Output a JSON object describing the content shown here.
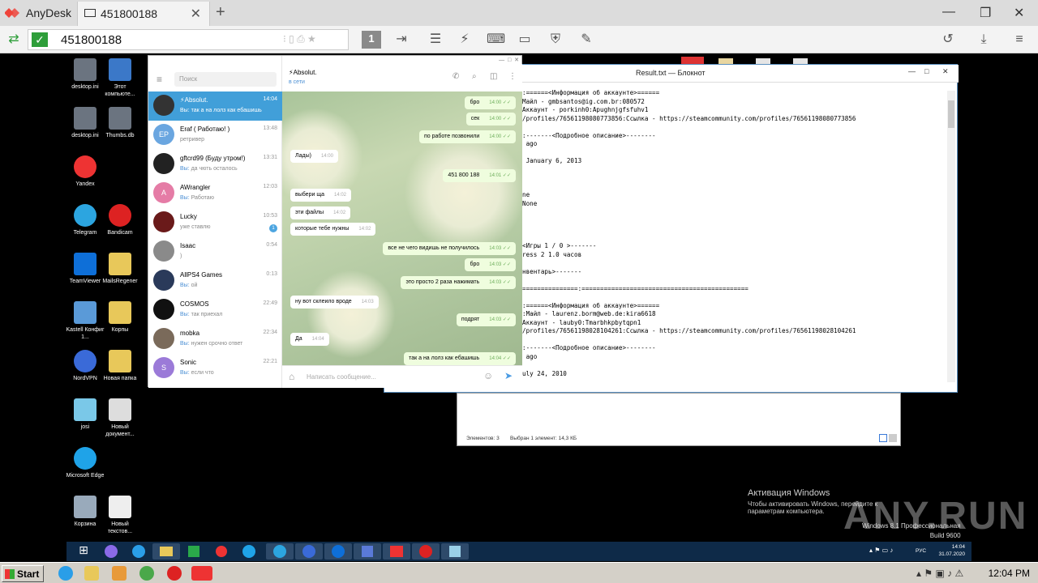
{
  "anydesk": {
    "app_name": "AnyDesk",
    "tab_label": "451800188",
    "address_value": "451800188",
    "monitor_label": "1"
  },
  "desktop_icons": [
    {
      "label": "desktop.ini",
      "color": "#6b7480"
    },
    {
      "label": "Этот компьюте...",
      "color": "#3b78c8"
    },
    {
      "label": "desktop.ini",
      "color": "#6b7480"
    },
    {
      "label": "Thumbs.db",
      "color": "#6b7480"
    },
    {
      "label": "Yandex",
      "color": "#e33"
    },
    {
      "label": "Telegram",
      "color": "#2ca5e0"
    },
    {
      "label": "Bandicam",
      "color": "#d22"
    },
    {
      "label": "TeamViewer",
      "color": "#0e6fd8"
    },
    {
      "label": "MailsRegener",
      "color": "#e8c85a"
    },
    {
      "label": "Kastell Конфиг 1...",
      "color": "#5a9ad8"
    },
    {
      "label": "Корпы",
      "color": "#e8c85a"
    },
    {
      "label": "NordVPN",
      "color": "#3a6ad8"
    },
    {
      "label": "Новая папка",
      "color": "#e8c85a"
    },
    {
      "label": "josi",
      "color": "#7ac8e8"
    },
    {
      "label": "Новый документ...",
      "color": "#dddddd"
    },
    {
      "label": "Microsoft Edge",
      "color": "#1fa3e8"
    },
    {
      "label": "Корзина",
      "color": "#9ab"
    },
    {
      "label": "Новый текстов...",
      "color": "#eeeeee"
    }
  ],
  "telegram": {
    "search_placeholder": "Поиск",
    "chats": [
      {
        "name": "⚡Absolut.",
        "preview": "Вы: так а на лолз как ебашишь",
        "time": "14:04",
        "avatar_color": "#333333",
        "avatar_text": ""
      },
      {
        "name": "Eraf ( Работаю! )",
        "preview": "ретривер",
        "time": "13:48",
        "avatar_color": "#6aa6e0",
        "avatar_text": "EP"
      },
      {
        "name": "gftcrd99 (Буду утром!)",
        "preview_you": "Вы:",
        "preview": " да чють осталось",
        "time": "13:31",
        "avatar_color": "#222222",
        "avatar_text": ""
      },
      {
        "name": "AWrangler",
        "preview_you": "Вы:",
        "preview": " Работаю",
        "time": "12:03",
        "avatar_color": "#e57ca6",
        "avatar_text": "A"
      },
      {
        "name": "Lucky",
        "preview": "уже ставлю",
        "time": "10:53",
        "avatar_color": "#6a1a1a",
        "avatar_text": "",
        "badge": "1"
      },
      {
        "name": "Isaac",
        "preview": ")",
        "time": "0:54",
        "avatar_color": "#8a8a8a",
        "avatar_text": ""
      },
      {
        "name": "AllPS4 Games",
        "preview_you": "Вы:",
        "preview": " ой",
        "time": "0:13",
        "avatar_color": "#2a3a5a",
        "avatar_text": ""
      },
      {
        "name": "COSMOS",
        "preview_you": "Вы:",
        "preview": " так приехал",
        "time": "22:49",
        "avatar_color": "#111111",
        "avatar_text": ""
      },
      {
        "name": "mobka",
        "preview_you": "Вы:",
        "preview": " нужен срочно ответ",
        "time": "22:34",
        "avatar_color": "#7a6a5a",
        "avatar_text": ""
      },
      {
        "name": "Sonic",
        "preview_you": "Вы:",
        "preview": " если что",
        "time": "22:21",
        "avatar_color": "#9b7ad8",
        "avatar_text": "S"
      }
    ],
    "active_chat": {
      "name": "⚡Absolut.",
      "status": "в сети"
    },
    "messages": [
      {
        "text": "бро",
        "time": "14:00",
        "dir": "out"
      },
      {
        "text": "сек",
        "time": "14:00",
        "dir": "out"
      },
      {
        "text": "по работе позвонили",
        "time": "14:00",
        "dir": "out"
      },
      {
        "text": "Лады)",
        "time": "14:00",
        "dir": "in"
      },
      {
        "text": "451 800 188",
        "time": "14:01",
        "dir": "out"
      },
      {
        "text": "выбери ща",
        "time": "14:02",
        "dir": "in"
      },
      {
        "text": "эти файлы",
        "time": "14:02",
        "dir": "in"
      },
      {
        "text": "которые тебе нужны",
        "time": "14:02",
        "dir": "in"
      },
      {
        "text": "все не чего видишь не получилось",
        "time": "14:03",
        "dir": "out"
      },
      {
        "text": "бро",
        "time": "14:03",
        "dir": "out"
      },
      {
        "text": "это просто 2 раза нажимать",
        "time": "14:03",
        "dir": "out"
      },
      {
        "text": "ну вот склеило вроде",
        "time": "14:03",
        "dir": "in"
      },
      {
        "text": "подрят",
        "time": "14:03",
        "dir": "out"
      },
      {
        "text": "Да",
        "time": "14:04",
        "dir": "in"
      },
      {
        "text": "так а на лолз как ебашишь",
        "time": "14:04",
        "dir": "out"
      }
    ],
    "input_placeholder": "Написать сообщение..."
  },
  "notepad": {
    "title": "Result.txt — Блокнот",
    "lines": [
      ":======<Информация об аккаунте>======",
      "Майл - gmbsantos@ig.com.br:080572",
      "Аккаунт - porkinh0:Apughnjgfsfuhv1",
      "/profiles/76561198080773856:Ссылка - https://steamcommunity.com/profiles/76561198080773856",
      "",
      ":-------<Подробное описание>--------",
      " ago",
      "",
      " January 6, 2013",
      "",
      "",
      "",
      "ne",
      "None",
      "",
      "",
      "",
      "",
      "<Игры 1 / 0 >-------",
      "ress 2 1.0 часов",
      "",
      "нвентарь>-------",
      "",
      "===============:=============================================",
      "",
      ":======<Информация об аккаунте>======",
      ":Майл - laurenz.borm@web.de:kira6618",
      "Аккаунт - lauby0:Tmarbhkpbytqpn1",
      "/profiles/76561198028104261:Ссылка - https://steamcommunity.com/profiles/76561198028104261",
      "",
      ":-------<Подробное описание>--------",
      " ago",
      "",
      "uly 24, 2010"
    ]
  },
  "explorer": {
    "status_items": "Элементов: 3",
    "status_selected": "Выбран 1 элемент: 14,3 КБ"
  },
  "remote_taskbar": {
    "lang": "РУС",
    "time": "14:04",
    "date": "31.07.2020"
  },
  "activation": {
    "title": "Активация Windows",
    "text": "Чтобы активировать Windows, перейдите к параметрам компьютера.",
    "build1": "Windows 8.1 Профессиональная",
    "build2": "Build 9600"
  },
  "watermark": "ANY.RUN",
  "local_taskbar": {
    "start_label": "Start",
    "clock": "12:04 PM"
  }
}
